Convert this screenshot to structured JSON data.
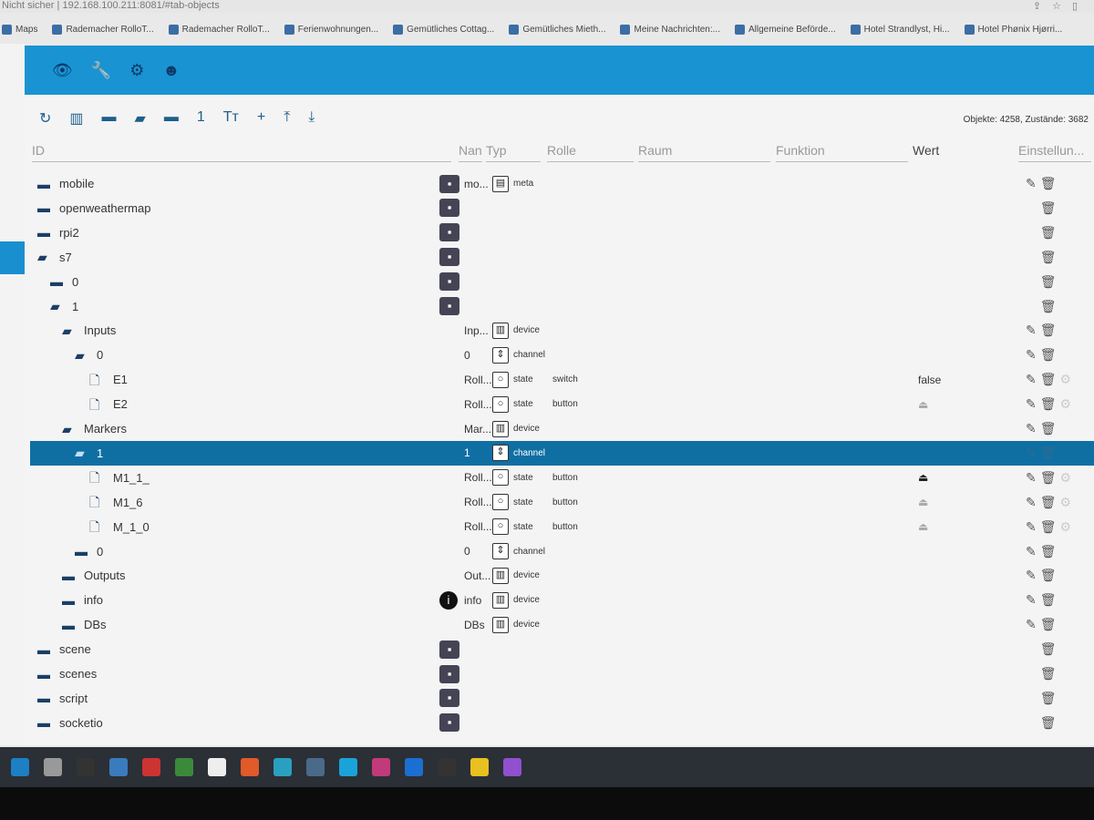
{
  "browser": {
    "security": "Nicht sicher",
    "url": "192.168.100.211:8081/#tab-objects",
    "bookmarks": [
      "Maps",
      "Rademacher RolloT...",
      "Rademacher RolloT...",
      "Ferienwohnungen...",
      "Gemütliches Cottag...",
      "Gemütliches Mieth...",
      "Meine Nachrichten:...",
      "Allgemeine Beförde...",
      "Hotel Strandlyst, Hi...",
      "Hotel Phønix Hjørri..."
    ]
  },
  "header": {
    "icons": [
      "eye-icon",
      "wrench-icon",
      "gear-icon",
      "user-icon"
    ],
    "accent": "#1a93d2"
  },
  "toolbar": {
    "icons": [
      "refresh-icon",
      "columns-icon",
      "folder-icon",
      "folder-open-icon",
      "folder-icon",
      "number-icon",
      "text-size-icon",
      "add-icon",
      "upload-icon",
      "download-icon"
    ],
    "glyphs": [
      "↻",
      "▥",
      "▬",
      "▰",
      "▬",
      "1",
      "Tт",
      "+",
      "⤒",
      "⤓"
    ],
    "counts": "Objekte: 4258, Zustände: 3682"
  },
  "columns": {
    "id": "ID",
    "name": "Nan",
    "type": "Typ",
    "role": "Rolle",
    "room": "Raum",
    "function": "Funktion",
    "value": "Wert",
    "settings": "Einstellun..."
  },
  "rows": [
    {
      "id": "mobile",
      "level": 0,
      "kind": "folder",
      "name": "mo...",
      "type": "meta",
      "edit": true
    },
    {
      "id": "openweathermap",
      "level": 0,
      "kind": "folder"
    },
    {
      "id": "rpi2",
      "level": 0,
      "kind": "folder"
    },
    {
      "id": "s7",
      "level": 0,
      "kind": "folder-open"
    },
    {
      "id": "0",
      "level": 1,
      "kind": "folder"
    },
    {
      "id": "1",
      "level": 1,
      "kind": "folder-open"
    },
    {
      "id": "Inputs",
      "level": 2,
      "kind": "folder-open",
      "name": "Inp...",
      "type": "device",
      "edit": true
    },
    {
      "id": "0",
      "level": 3,
      "kind": "folder-open",
      "name": "0",
      "type": "channel",
      "edit": true
    },
    {
      "id": "E1",
      "level": 4,
      "kind": "file",
      "name": "Roll...",
      "type": "state",
      "role": "switch",
      "value": "false",
      "edit": true,
      "settings": true
    },
    {
      "id": "E2",
      "level": 4,
      "kind": "file",
      "name": "Roll...",
      "type": "state",
      "role": "button",
      "button": true,
      "edit": true,
      "settings": true
    },
    {
      "id": "Markers",
      "level": 2,
      "kind": "folder-open",
      "name": "Mar...",
      "type": "device",
      "edit": true
    },
    {
      "id": "1",
      "level": 3,
      "kind": "folder-open",
      "name": "1",
      "type": "channel",
      "edit": true,
      "selected": true
    },
    {
      "id": "M1_1_",
      "level": 4,
      "kind": "file",
      "name": "Roll...",
      "type": "state",
      "role": "button",
      "button": true,
      "edit": true,
      "settings": true
    },
    {
      "id": "M1_6",
      "level": 4,
      "kind": "file",
      "name": "Roll...",
      "type": "state",
      "role": "button",
      "button": true,
      "edit": true,
      "settings": true
    },
    {
      "id": "M_1_0",
      "level": 4,
      "kind": "file",
      "name": "Roll...",
      "type": "state",
      "role": "button",
      "button": true,
      "edit": true,
      "settings": true
    },
    {
      "id": "0",
      "level": 3,
      "kind": "folder",
      "name": "0",
      "type": "channel",
      "edit": true
    },
    {
      "id": "Outputs",
      "level": 2,
      "kind": "folder",
      "name": "Out...",
      "type": "device",
      "edit": true
    },
    {
      "id": "info",
      "level": 2,
      "kind": "folder",
      "name": "info",
      "type": "device",
      "edit": true,
      "infoIcon": true
    },
    {
      "id": "DBs",
      "level": 2,
      "kind": "folder",
      "name": "DBs",
      "type": "device",
      "edit": true
    },
    {
      "id": "scene",
      "level": 0,
      "kind": "folder"
    },
    {
      "id": "scenes",
      "level": 0,
      "kind": "folder"
    },
    {
      "id": "script",
      "level": 0,
      "kind": "folder"
    },
    {
      "id": "socketio",
      "level": 0,
      "kind": "folder"
    }
  ],
  "selected_color": "#0f6fa3"
}
